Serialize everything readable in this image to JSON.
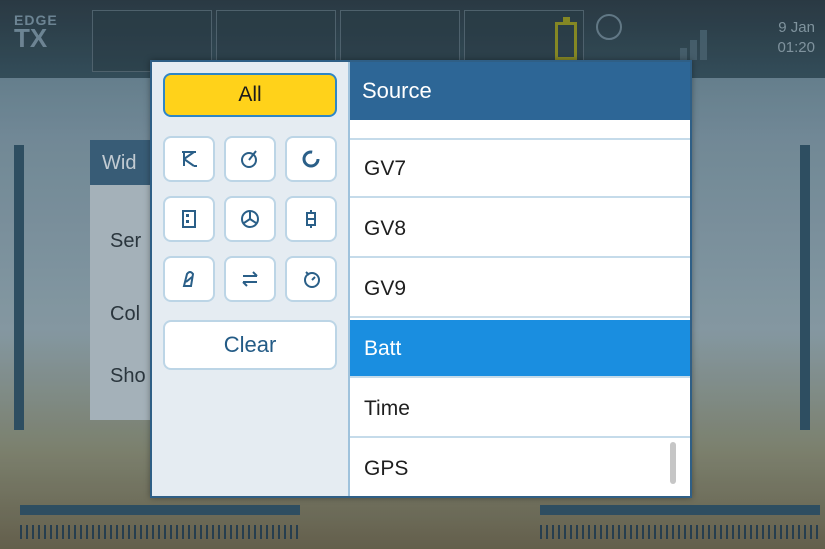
{
  "status_bar": {
    "logo_line1": "EDGE",
    "logo_line2": "TX",
    "date": "9 Jan",
    "time": "01:20"
  },
  "background_dialog": {
    "title_partial": "Wid",
    "rows": [
      "Ser",
      "Col",
      "Sho"
    ]
  },
  "filter_panel": {
    "all_label": "All",
    "clear_label": "Clear",
    "icons": [
      "input-icon",
      "logical-switch-icon",
      "rotary-icon",
      "channel-icon",
      "trainer-icon",
      "switch-icon",
      "telemetry-icon",
      "swap-icon",
      "timer-icon"
    ]
  },
  "source_list": {
    "header": "Source",
    "items": [
      {
        "label": "GV7",
        "selected": false
      },
      {
        "label": "GV8",
        "selected": false
      },
      {
        "label": "GV9",
        "selected": false
      },
      {
        "label": "Batt",
        "selected": true
      },
      {
        "label": "Time",
        "selected": false
      },
      {
        "label": "GPS",
        "selected": false
      }
    ]
  },
  "colors": {
    "accent_yellow": "#ffd21a",
    "selected_blue": "#1a8ee0",
    "header_blue": "#2d6696"
  }
}
